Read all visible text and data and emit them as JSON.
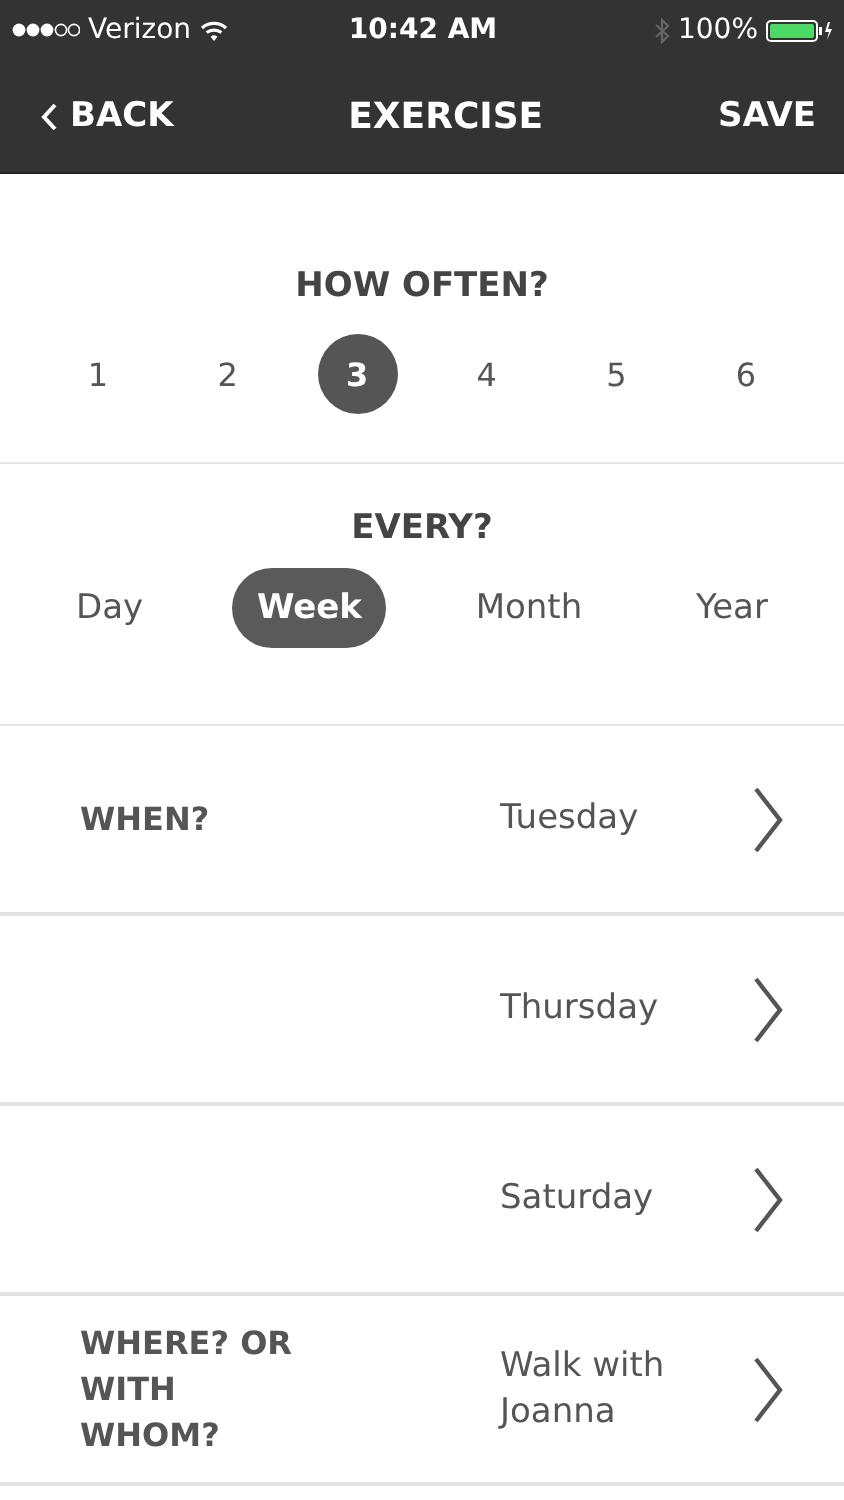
{
  "status_bar": {
    "carrier": "Verizon",
    "time": "10:42 AM",
    "battery": "100%"
  },
  "nav": {
    "back": "BACK",
    "title": "EXERCISE",
    "action": "SAVE"
  },
  "how_often": {
    "title": "HOW OFTEN?",
    "options": [
      {
        "label": "1",
        "selected": false
      },
      {
        "label": "2",
        "selected": false
      },
      {
        "label": "3",
        "selected": true
      },
      {
        "label": "4",
        "selected": false
      },
      {
        "label": "5",
        "selected": false
      },
      {
        "label": "6",
        "selected": false
      }
    ]
  },
  "every": {
    "title": "EVERY?",
    "options": [
      {
        "label": "Day",
        "selected": false
      },
      {
        "label": "Week",
        "selected": true
      },
      {
        "label": "Month",
        "selected": false
      },
      {
        "label": "Year",
        "selected": false
      }
    ]
  },
  "rows": [
    {
      "label": "WHEN?",
      "value": "Tuesday"
    },
    {
      "value": "Thursday"
    },
    {
      "value": "Saturday"
    },
    {
      "label": "WHERE? OR WITH WHOM?",
      "value": "Walk with Joanna"
    }
  ]
}
